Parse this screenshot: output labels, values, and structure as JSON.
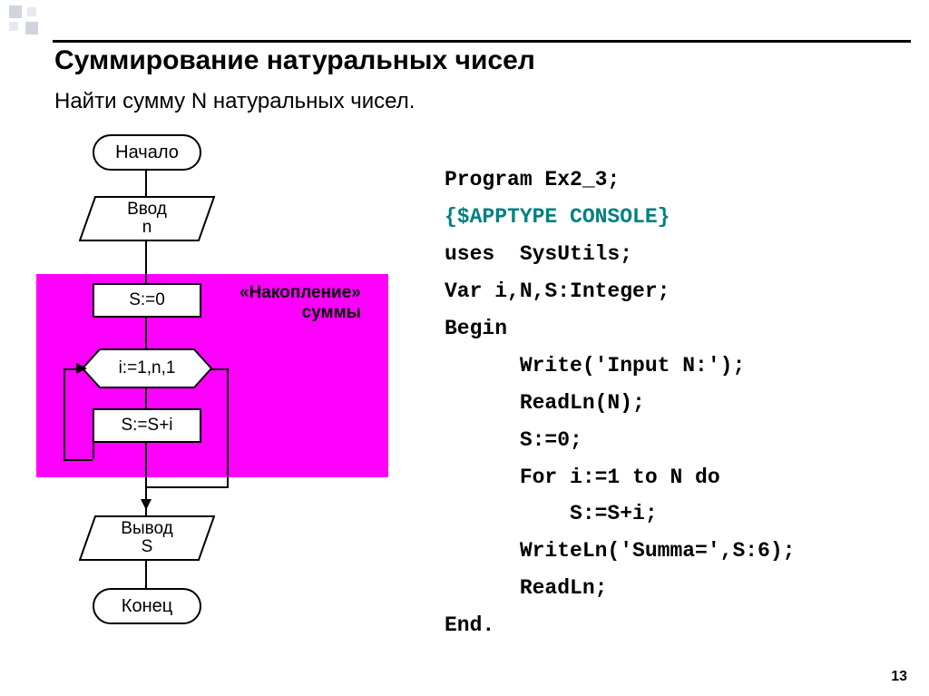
{
  "title": "Суммирование натуральных чисел",
  "subtitle": "Найти сумму N натуральных чисел.",
  "flowchart": {
    "start": "Начало",
    "input_l1": "Ввод",
    "input_l2": "n",
    "init": "S:=0",
    "loop": "i:=1,n,1",
    "body": "S:=S+i",
    "output_l1": "Вывод",
    "output_l2": "S",
    "end": "Конец",
    "annotation_l1": "«Накопление»",
    "annotation_l2": "суммы"
  },
  "code": {
    "l1": "Program Ex2_3;",
    "l2": "{$APPTYPE CONSOLE}",
    "l3": "uses  SysUtils;",
    "l4": "Var i,N,S:Integer;",
    "l5": "Begin",
    "l6": "      Write('Input N:');",
    "l7": "      ReadLn(N);",
    "l8": "      S:=0;",
    "l9": "      For i:=1 to N do",
    "l10": "          S:=S+i;",
    "l11": "      WriteLn('Summa=',S:6);",
    "l12": "      ReadLn;",
    "l13": "End."
  },
  "page_number": "13"
}
